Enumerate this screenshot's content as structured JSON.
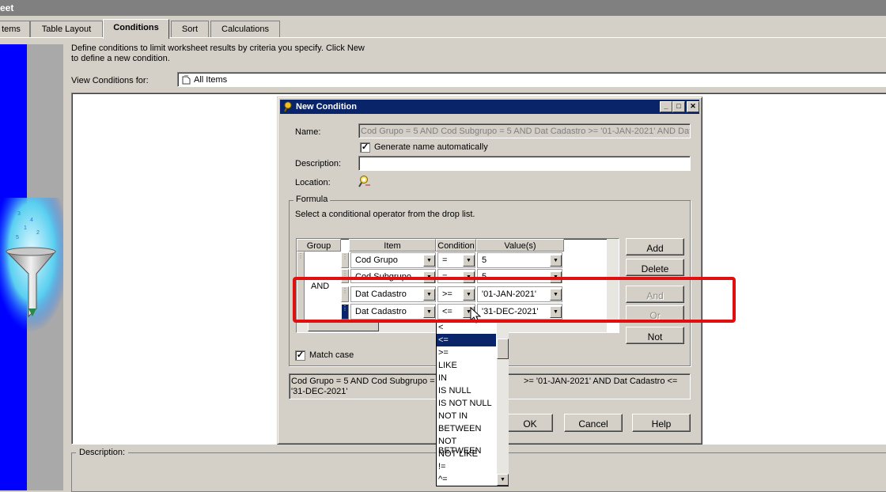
{
  "window": {
    "title": "eet"
  },
  "tabs": [
    "tems",
    "Table Layout",
    "Conditions",
    "Sort",
    "Calculations"
  ],
  "active_tab": "Conditions",
  "intro": {
    "line1": "Define conditions to limit worksheet results by criteria you specify. Click New",
    "line2": "to define a new condition."
  },
  "view_conditions": {
    "label": "View Conditions for:",
    "value": "All Items"
  },
  "description_label": "Description:",
  "dialog": {
    "title": "New Condition",
    "name_label": "Name:",
    "name_value": "Cod Grupo = 5 AND Cod Subgrupo = 5 AND Dat Cadastro >= '01-JAN-2021' AND Dat C",
    "generate_checkbox": "Generate name automatically",
    "description_label": "Description:",
    "location_label": "Location:",
    "formula_label": "Formula",
    "formula_hint": "Select a conditional operator from the drop list.",
    "grid_headers": [
      "Group",
      "Item",
      "Condition",
      "Value(s)"
    ],
    "group_value": "AND",
    "rows": [
      {
        "item": "Cod Grupo",
        "condition": "=",
        "value": "5"
      },
      {
        "item": "Cod Subgrupo",
        "condition": "=",
        "value": "5"
      },
      {
        "item": "Dat Cadastro",
        "condition": ">=",
        "value": "'01-JAN-2021'"
      },
      {
        "item": "Dat Cadastro",
        "condition": "<=",
        "value": "'31-DEC-2021'"
      }
    ],
    "buttons": {
      "add": "Add",
      "delete": "Delete",
      "and": "And",
      "or": "Or",
      "not": "Not"
    },
    "match_case": "Match case",
    "summary_left": "Cod Grupo = 5 AND Cod Subgrupo = 5",
    "summary_right": ">= '01-JAN-2021' AND Dat Cadastro <=",
    "summary_line2": "'31-DEC-2021'",
    "ok": "OK",
    "cancel": "Cancel",
    "help": "Help"
  },
  "dropdown_options": [
    "<",
    "<=",
    ">=",
    "LIKE",
    "IN",
    "IS NULL",
    "IS NOT NULL",
    "NOT IN",
    "BETWEEN",
    "NOT BETWEEN",
    "NOT LIKE",
    "!=",
    "^="
  ],
  "dropdown_selected": "<=",
  "colors": {
    "titlebar": "#0a246a",
    "highlight": "#e01010",
    "left_panel": "#0000ff"
  },
  "icons": [
    "funnel-icon",
    "document-icon",
    "location-icon",
    "dropdown-arrow-icon",
    "mouse-cursor-icon"
  ]
}
